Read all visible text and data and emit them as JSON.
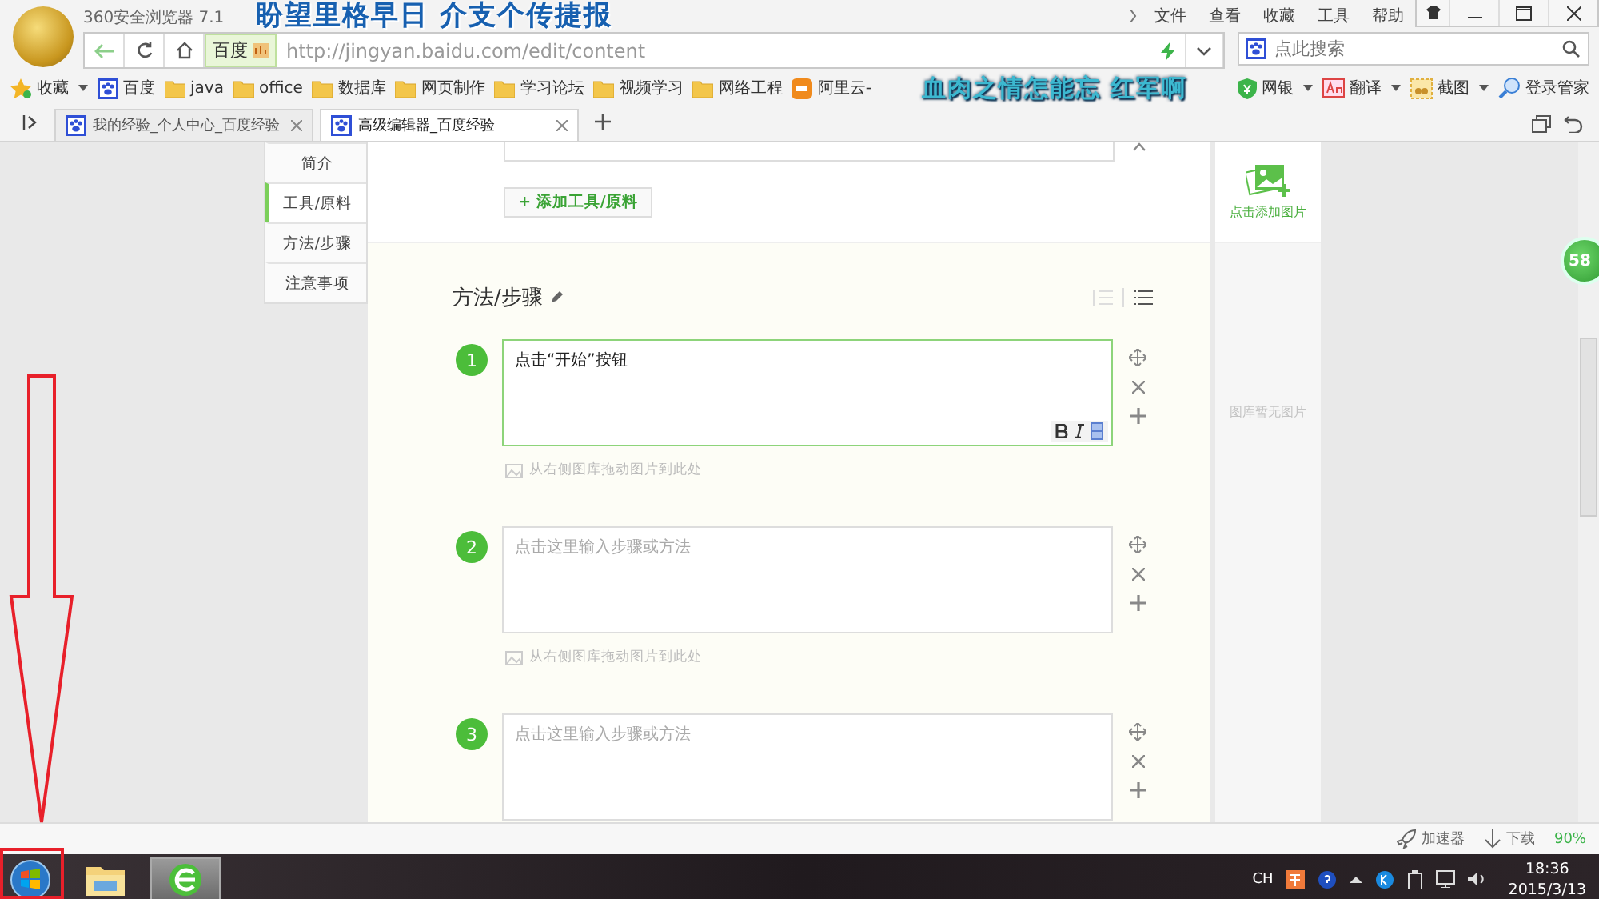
{
  "browser": {
    "title": "360安全浏览器 7.1",
    "menu": [
      "文件",
      "查看",
      "收藏",
      "工具",
      "帮助"
    ],
    "address": {
      "site": "百度",
      "url": "http://jingyan.baidu.com/edit/content"
    },
    "search": {
      "placeholder": "点此搜索"
    },
    "bookmarks": [
      {
        "label": "收藏",
        "kind": "star"
      },
      {
        "label": "百度",
        "kind": "paw"
      },
      {
        "label": "java",
        "kind": "folder"
      },
      {
        "label": "office",
        "kind": "folder"
      },
      {
        "label": "数据库",
        "kind": "folder"
      },
      {
        "label": "网页制作",
        "kind": "folder"
      },
      {
        "label": "学习论坛",
        "kind": "folder"
      },
      {
        "label": "视频学习",
        "kind": "folder"
      },
      {
        "label": "网络工程",
        "kind": "folder"
      },
      {
        "label": "阿里云-",
        "kind": "cloud"
      }
    ],
    "tools": [
      {
        "label": "网银",
        "kind": "shield"
      },
      {
        "label": "翻译",
        "kind": "translate"
      },
      {
        "label": "截图",
        "kind": "scissors"
      },
      {
        "label": "登录管家",
        "kind": "key"
      }
    ],
    "tabs": [
      {
        "label": "我的经验_个人中心_百度经验",
        "selected": false
      },
      {
        "label": "高级编辑器_百度经验",
        "selected": true
      }
    ]
  },
  "lyrics": [
    "盼望里格早日 介支个传捷报",
    "血肉之情怎能忘 红军啊"
  ],
  "nav": [
    {
      "label": "简介",
      "selected": false
    },
    {
      "label": "工具/原料",
      "selected": true
    },
    {
      "label": "方法/步骤",
      "selected": false
    },
    {
      "label": "注意事项",
      "selected": false
    }
  ],
  "tools_section": {
    "add_button": "+ 添加工具/原料"
  },
  "steps_section": {
    "title": "方法/步骤",
    "steps": [
      {
        "number": "1",
        "value": "点击“开始”按钮",
        "focused": true,
        "hint": "从右侧图库拖动图片到此处"
      },
      {
        "number": "2",
        "placeholder": "点击这里输入步骤或方法",
        "focused": false,
        "hint": "从右侧图库拖动图片到此处"
      },
      {
        "number": "3",
        "placeholder": "点击这里输入步骤或方法",
        "focused": false
      }
    ]
  },
  "gallery": {
    "add_label": "点击添加图片",
    "empty_text": "图库暂无图片"
  },
  "float_badge": "58",
  "status_bar": {
    "items": [
      {
        "label": "加速器",
        "kind": "rocket"
      },
      {
        "label": "下载",
        "kind": "download"
      }
    ],
    "zoom": "90%"
  },
  "taskbar": {
    "lang": "CH",
    "time": "18:36",
    "date": "2015/3/13"
  }
}
